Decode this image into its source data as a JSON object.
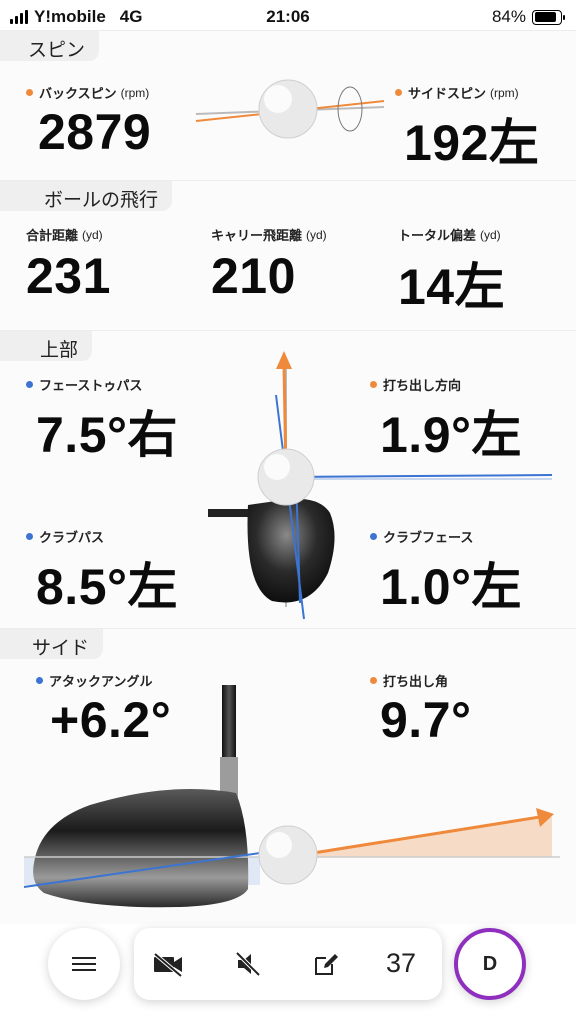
{
  "status": {
    "carrier": "Y!mobile",
    "network": "4G",
    "time": "21:06",
    "battery": "84%",
    "battery_level": 0.84
  },
  "spin": {
    "title": "スピン",
    "back_label": "バックスピン",
    "back_unit": "(rpm)",
    "back_value": "2879",
    "side_label": "サイドスピン",
    "side_unit": "(rpm)",
    "side_value": "192左"
  },
  "flight": {
    "title": "ボールの飛行",
    "total_label": "合計距離",
    "total_unit": "(yd)",
    "total_value": "231",
    "carry_label": "キャリー飛距離",
    "carry_unit": "(yd)",
    "carry_value": "210",
    "dev_label": "トータル偏差",
    "dev_unit": "(yd)",
    "dev_value": "14左"
  },
  "top": {
    "title": "上部",
    "face_to_path_label": "フェーストゥパス",
    "face_to_path_value": "7.5°右",
    "launch_dir_label": "打ち出し方向",
    "launch_dir_value": "1.9°左",
    "club_path_label": "クラブパス",
    "club_path_value": "8.5°左",
    "club_face_label": "クラブフェース",
    "club_face_value": "1.0°左"
  },
  "side": {
    "title": "サイド",
    "attack_label": "アタックアングル",
    "attack_value": "+6.2°",
    "launch_angle_label": "打ち出し角",
    "launch_angle_value": "9.7°"
  },
  "toolbar": {
    "shot_count": "37",
    "profile_initial": "D"
  },
  "colors": {
    "orange": "#ef8a3c",
    "blue": "#3b74d3",
    "profile_ring": "#8f2fbf"
  },
  "icons": [
    "menu-icon",
    "video-off-icon",
    "mute-icon",
    "edit-icon"
  ]
}
